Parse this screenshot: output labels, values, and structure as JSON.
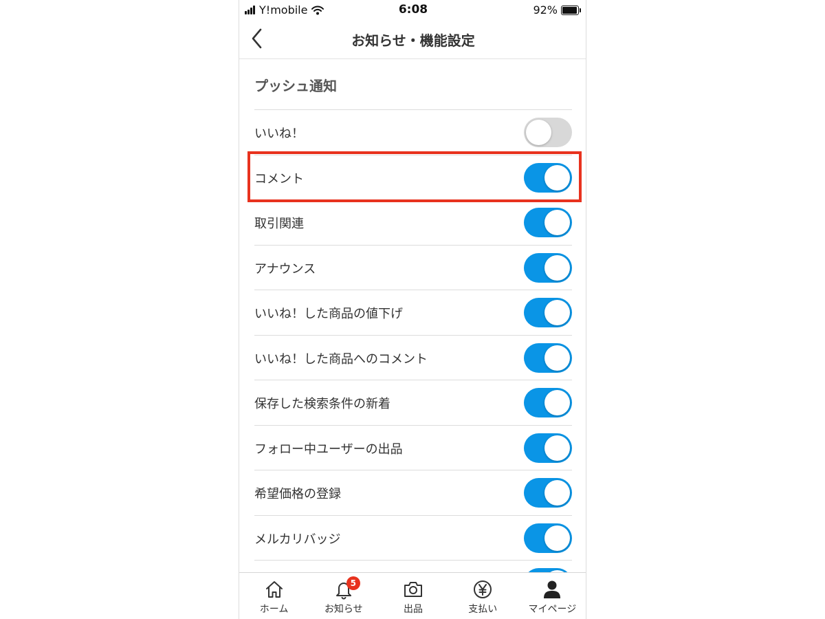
{
  "status_bar": {
    "carrier": "Y!mobile",
    "time": "6:08",
    "battery": "92%"
  },
  "nav": {
    "title": "お知らせ・機能設定"
  },
  "section": {
    "title": "プッシュ通知"
  },
  "settings": [
    {
      "label": "いいね！",
      "on": false
    },
    {
      "label": "コメント",
      "on": true
    },
    {
      "label": "取引関連",
      "on": true
    },
    {
      "label": "アナウンス",
      "on": true
    },
    {
      "label": "いいね！した商品の値下げ",
      "on": true
    },
    {
      "label": "いいね！した商品へのコメント",
      "on": true
    },
    {
      "label": "保存した検索条件の新着",
      "on": true
    },
    {
      "label": "フォロー中ユーザーの出品",
      "on": true
    },
    {
      "label": "希望価格の登録",
      "on": true
    },
    {
      "label": "メルカリバッジ",
      "on": true
    },
    {
      "label": "",
      "on": true
    }
  ],
  "highlighted_setting": "コメント",
  "tabbar": [
    {
      "label": "ホーム",
      "icon": "home-icon"
    },
    {
      "label": "お知らせ",
      "icon": "bell-icon",
      "badge": "5"
    },
    {
      "label": "出品",
      "icon": "camera-icon"
    },
    {
      "label": "支払い",
      "icon": "yen-icon"
    },
    {
      "label": "マイページ",
      "icon": "person-icon"
    }
  ],
  "colors": {
    "toggle_on": "#0a95e6",
    "toggle_off": "#d8d8d8",
    "highlight": "#e8321e",
    "badge": "#e8321e"
  }
}
